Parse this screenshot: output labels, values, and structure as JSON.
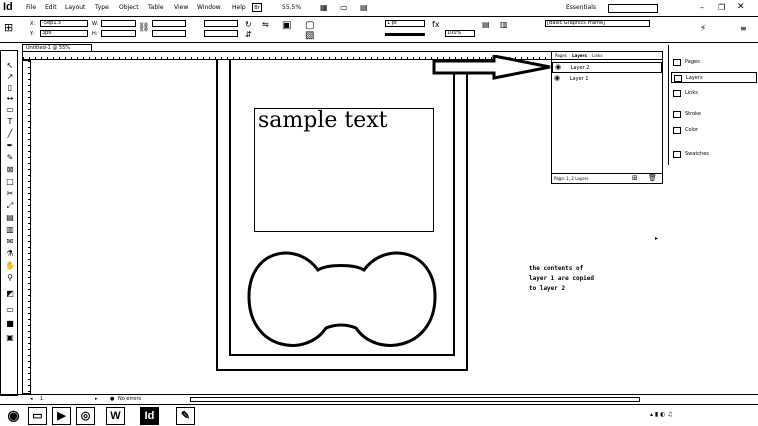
{
  "app": {
    "icon_label": "Id",
    "zoom": "55.5%",
    "workspace": "Essentials",
    "search_placeholder": ""
  },
  "menu": [
    "File",
    "Edit",
    "Layout",
    "Type",
    "Object",
    "Table",
    "View",
    "Window",
    "Help"
  ],
  "control": {
    "x_label": "X:",
    "x_value": "-58p1.5",
    "y_label": "Y:",
    "y_value": "3p6",
    "w_label": "W:",
    "h_label": "H:",
    "stroke_weight": "1 pt",
    "opacity": "100%",
    "style_name": "[Basic Graphics Frame]"
  },
  "document": {
    "tab_title": "Untitled-1 @ 55%",
    "sample_text": "sample text",
    "note_lines": [
      "the contents of",
      "layer 1 are copied",
      "to layer 2"
    ]
  },
  "layers_panel": {
    "tabs": [
      "Pages",
      "Layers",
      "Links"
    ],
    "layers": [
      "Layer 2",
      "Layer 1"
    ],
    "footer": "Page: 1, 2 Layers"
  },
  "dock": {
    "items": [
      "Pages",
      "Layers",
      "Links",
      "Stroke",
      "Color",
      "Swatches"
    ]
  },
  "status": {
    "page": "1",
    "errors": "No errors"
  },
  "taskbar": {
    "items": [
      "W",
      "Id"
    ]
  }
}
